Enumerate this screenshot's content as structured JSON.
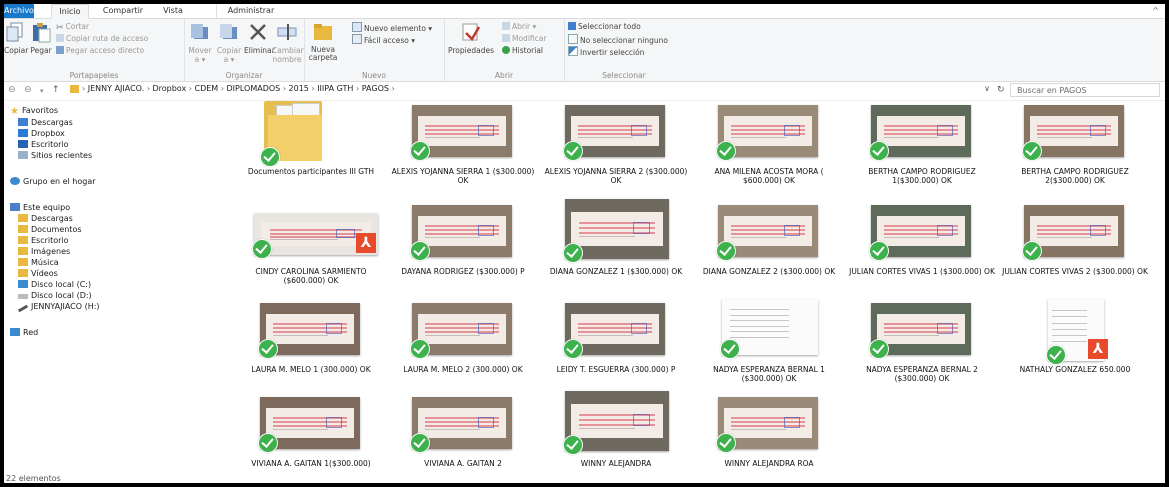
{
  "ribbon": {
    "tabs": [
      "Archivo",
      "Inicio",
      "Compartir",
      "Vista",
      "Administrar"
    ],
    "clipboard": {
      "copy": "Copiar",
      "paste": "Pegar",
      "cut": "Cortar",
      "copy_path": "Copiar ruta de acceso",
      "paste_shortcut": "Pegar acceso directo",
      "label": "Portapapeles"
    },
    "organize": {
      "move": "Mover a ▾",
      "copy_to": "Copiar a ▾",
      "delete": "Eliminar",
      "rename": "Cambiar nombre",
      "label": "Organizar"
    },
    "new": {
      "new_folder": "Nueva carpeta",
      "new_item": "Nuevo elemento ▾",
      "easy_access": "Fácil acceso ▾",
      "label": "Nuevo"
    },
    "open": {
      "properties": "Propiedades",
      "open": "Abrir ▾",
      "edit": "Modificar",
      "history": "Historial",
      "label": "Abrir"
    },
    "select": {
      "select_all": "Seleccionar todo",
      "select_none": "No seleccionar ninguno",
      "invert": "Invertir selección",
      "label": "Seleccionar"
    }
  },
  "address": {
    "path": [
      "JENNY AJIACO.",
      "Dropbox",
      "CDEM",
      "DIPLOMADOS",
      "2015",
      "IIIPA GTH",
      "PAGOS"
    ],
    "search_placeholder": "Buscar en PAGOS"
  },
  "sidebar": {
    "favorites": "Favoritos",
    "fav_items": [
      "Descargas",
      "Dropbox",
      "Escritorio",
      "Sitios recientes"
    ],
    "homegroup": "Grupo en el hogar",
    "this_pc": "Este equipo",
    "pc_items": [
      "Descargas",
      "Documentos",
      "Escritorio",
      "Imágenes",
      "Música",
      "Vídeos",
      "Disco local (C:)",
      "Disco local (D:)",
      "JENNYAJIACO (H:)"
    ],
    "network": "Red"
  },
  "status": "22 elementos",
  "files": [
    {
      "name": "Documentos participantes III GTH",
      "kind": "folder"
    },
    {
      "name": "ALEXIS YOJANNA SIERRA 1 ($300.000) OK",
      "kind": "photo"
    },
    {
      "name": "ALEXIS YOJANNA SIERRA 2 ($300.000) OK",
      "kind": "photo"
    },
    {
      "name": "ANA MILENA ACOSTA MORA ( $600.000) OK",
      "kind": "photo"
    },
    {
      "name": "BERTHA CAMPO RODRIGUEZ 1($300.000) OK",
      "kind": "photo"
    },
    {
      "name": "BERTHA CAMPO RODRIGUEZ 2($300.000) OK",
      "kind": "photo"
    },
    {
      "name": "CINDY CAROLINA SARMIENTO ($600.000) OK",
      "kind": "pdf"
    },
    {
      "name": "DAYANA RODRIGEZ ($300.000) P",
      "kind": "photo"
    },
    {
      "name": "DIANA GONZALEZ 1 ($300.000) OK",
      "kind": "photo"
    },
    {
      "name": "DIANA GONZALEZ 2 ($300.000) OK",
      "kind": "photo"
    },
    {
      "name": "JULIAN CORTES VIVAS 1 ($300.000) OK",
      "kind": "photo"
    },
    {
      "name": "JULIAN CORTES VIVAS 2 ($300.000) OK",
      "kind": "photo"
    },
    {
      "name": "LAURA M. MELO 1 (300.000) OK",
      "kind": "photo"
    },
    {
      "name": "LAURA M. MELO 2 (300.000) OK",
      "kind": "photo"
    },
    {
      "name": "LEIDY T. ESGUERRA (300.000) P",
      "kind": "photo"
    },
    {
      "name": "NADYA ESPERANZA BERNAL 1 ($300.000) OK",
      "kind": "scan"
    },
    {
      "name": "NADYA ESPERANZA BERNAL 2 ($300.000) OK",
      "kind": "photo"
    },
    {
      "name": "NATHALY GONZALEZ 650.000",
      "kind": "pdfdoc"
    },
    {
      "name": "VIVIANA A. GAITAN 1($300.000)",
      "kind": "photo"
    },
    {
      "name": "VIVIANA A. GAITAN 2",
      "kind": "photo"
    },
    {
      "name": "WINNY ALEJANDRA",
      "kind": "photo"
    },
    {
      "name": "WINNY ALEJANDRA ROA",
      "kind": "photo"
    }
  ]
}
